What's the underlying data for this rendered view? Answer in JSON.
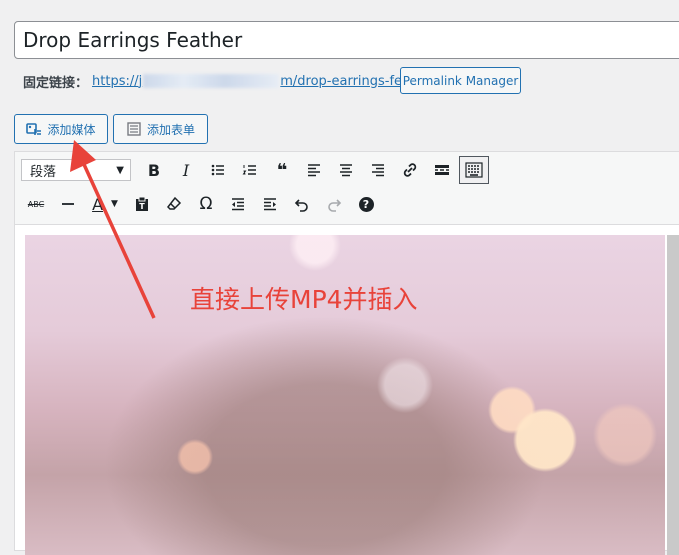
{
  "post": {
    "title": "Drop Earrings Feather"
  },
  "permalink": {
    "label": "固定链接：",
    "url_prefix": "https://j",
    "url_suffix": "m/drop-earrings-feather.html",
    "manager_button": "Permalink Manager"
  },
  "media_buttons": {
    "add_media": "添加媒体",
    "add_form": "添加表单"
  },
  "toolbar": {
    "format_select": "段落",
    "row1": [
      "bold-icon",
      "italic-icon",
      "bullet-list-icon",
      "numbered-list-icon",
      "blockquote-icon",
      "align-left-icon",
      "align-center-icon",
      "align-right-icon",
      "link-icon",
      "read-more-icon",
      "toolbar-toggle-icon"
    ],
    "row2": [
      "strikethrough-icon",
      "horizontal-line-icon",
      "text-color-icon",
      "paste-text-icon",
      "clear-formatting-icon",
      "special-character-icon",
      "outdent-icon",
      "indent-icon",
      "undo-icon",
      "redo-icon",
      "help-icon"
    ],
    "glyphs": {
      "bold": "B",
      "italic": "I",
      "blockquote": "❝",
      "omega": "Ω",
      "text_color": "A",
      "help": "?"
    }
  },
  "annotation": {
    "text": "直接上传MP4并插入",
    "color": "#e8433a"
  },
  "colors": {
    "accent": "#2271b1",
    "background": "#f0f0f1"
  }
}
